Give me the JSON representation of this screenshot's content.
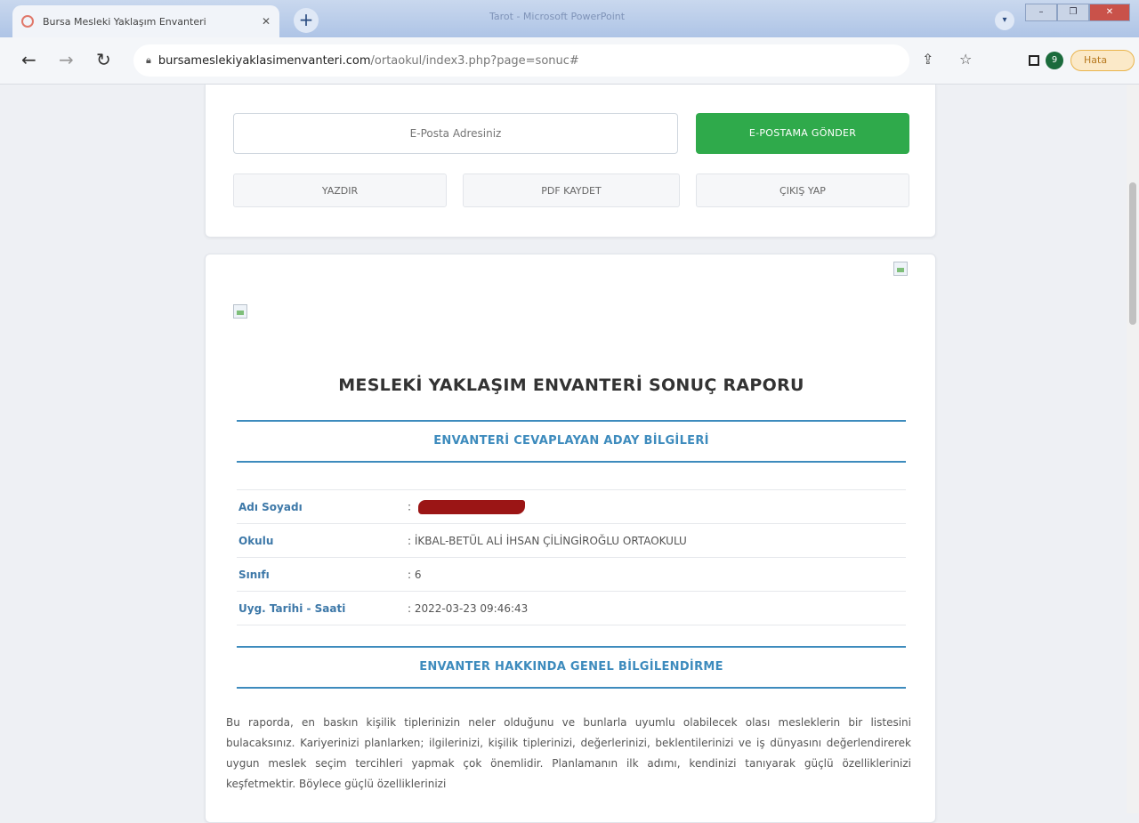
{
  "browser": {
    "tab_title": "Bursa Mesleki Yaklaşım Envanteri",
    "tab_close": "✕",
    "new_tab": "+",
    "window_title": "Tarot - Microsoft PowerPoint",
    "url_host": "bursamesleki­yaklasimenvanteri.com",
    "url_path": "/ortaokul/index3.php?page=sonuc#",
    "avatar_letter": "9",
    "update_label": "Hata"
  },
  "actions": {
    "email_placeholder": "E-Posta Adresiniz",
    "send_label": "E-POSTAMA GÖNDER",
    "print_label": "YAZDIR",
    "pdf_label": "PDF KAYDET",
    "logout_label": "ÇIKIŞ YAP"
  },
  "report": {
    "title": "MESLEKİ YAKLAŞIM ENVANTERİ SONUÇ RAPORU",
    "section1": "ENVANTERİ CEVAPLAYAN ADAY BİLGİLERİ",
    "rows": [
      {
        "label": "Adı Soyadı",
        "value": ": "
      },
      {
        "label": "Okulu",
        "value": ":  İKBAL-BETÜL ALİ İHSAN ÇİLİNGİROĞLU ORTAOKULU"
      },
      {
        "label": "Sınıfı",
        "value": ":  6"
      },
      {
        "label": "Uyg. Tarihi - Saati",
        "value": ":  2022-03-23 09:46:43"
      }
    ],
    "section2": "ENVANTER HAKKINDA GENEL BİLGİLENDİRME",
    "paragraph": "Bu raporda, en baskın kişilik tiplerinizin neler olduğunu ve bunlarla uyumlu olabilecek olası mesleklerin bir listesini bulacaksınız. Kariyerinizi planlarken; ilgilerinizi, kişilik tiplerinizi, değerlerinizi, beklentilerinizi ve iş dünyasını değerlendirerek uygun meslek seçim tercihleri yapmak çok önemlidir. Planlamanın ilk adımı, kendinizi tanıyarak güçlü özelliklerinizi keşfetmektir. Böylece güçlü özelliklerinizi"
  }
}
